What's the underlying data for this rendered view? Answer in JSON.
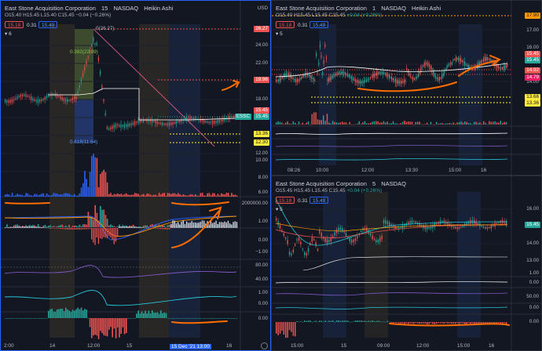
{
  "colors": {
    "bg": "#131722",
    "up": "#26a69a",
    "down": "#ef5350",
    "orange": "#ff6d00",
    "accent": "#2962ff",
    "grid": "#1e222d"
  },
  "left": {
    "title": [
      "East Stone Acquisition Corporation",
      "15",
      "NASDAQ",
      "Heikin Ashi"
    ],
    "ohlc": {
      "o": "O15.40",
      "h": "H15.45",
      "l": "L15.40",
      "c": "C15.45",
      "chg": "−0.04 (−0.26%)"
    },
    "price_boxes": [
      "15.18",
      "0.31",
      "15.49"
    ],
    "collapse": "6",
    "currency": "USD",
    "price_labels": [
      "24.00",
      "22.00",
      "20.00",
      "18.00",
      "16.00",
      "14.00",
      "12.00",
      "10.00",
      "8.00",
      "6.00"
    ],
    "tags": {
      "t1": "26.27",
      "t2": "19.96",
      "t3": "15.45",
      "t4": "ESSC",
      "t5": "15.45",
      "t6": "13.36",
      "t7": "12.30"
    },
    "vol_label": "2000000.00",
    "macd_labels": [
      "1.00",
      "0.00",
      "−1.00"
    ],
    "osc_labels": [
      "80.00",
      "40.00",
      "1.00",
      "0.00",
      "−1.00",
      "0.00"
    ],
    "fib": {
      "top": "0(26.27)",
      "mid": "0.382(22.89)",
      "bottom": "0.618(11.64)"
    },
    "time": [
      "2:00",
      "14",
      "12:00",
      "15",
      "16"
    ],
    "time_hi": "15 Dec '21   13:00"
  },
  "top_right": {
    "title": [
      "East Stone Acquisition Corporation",
      "1",
      "NASDAQ",
      "Heikin Ashi"
    ],
    "ohlc": {
      "o": "O15.40",
      "h": "H15.45",
      "l": "L15.45",
      "c": "C15.45",
      "chg": "+0.04 (+0.26%)"
    },
    "price_boxes": [
      "15.18",
      "0.31",
      "15.49"
    ],
    "collapse": "5",
    "price_labels": [
      "17.00",
      "16.00",
      "15.00",
      "14.00",
      "13.00",
      "12.00"
    ],
    "tags": {
      "t1": "17.90",
      "t2": "15.45",
      "t3": "15.45",
      "t4": "14.92",
      "t5": "14.79",
      "t6": "13.66",
      "t7": "13.36"
    },
    "time": [
      "08:26",
      "10:00",
      "12:00",
      "13:30",
      "15:00",
      "16"
    ]
  },
  "bottom_right": {
    "title": [
      "East Stone Acquisition Corporation",
      "5",
      "NASDAQ"
    ],
    "ohlc": {
      "o": "O15.45",
      "h": "H15.45",
      "l": "L15.45",
      "c": "C15.45",
      "chg": "+0.04 (+0.26%)"
    },
    "price_boxes": [
      "15.18",
      "0.31",
      "15.49"
    ],
    "collapse": "5",
    "price_labels": [
      "16.00",
      "15.00",
      "14.00",
      "13.00",
      "12.00"
    ],
    "tags": {
      "t1": "15.45"
    },
    "osc_labels": [
      "1.00",
      "0.00",
      "50.00",
      "0.00",
      "0.00"
    ],
    "time": [
      "15:00",
      "15",
      "09:00",
      "12:00",
      "15:00",
      "16"
    ]
  }
}
